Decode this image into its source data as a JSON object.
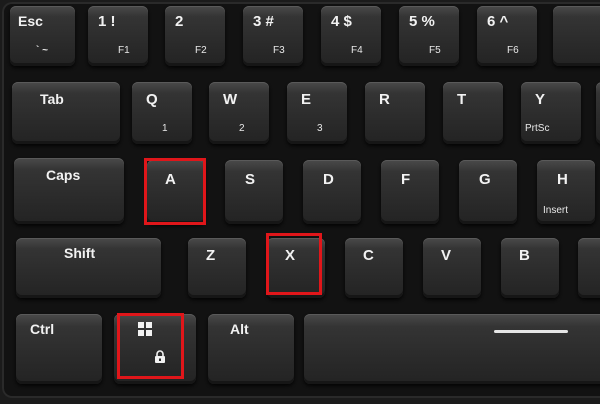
{
  "keys": {
    "esc": {
      "label": "Esc",
      "sub": "` ~"
    },
    "one": {
      "label": "1 !",
      "sub": "F1"
    },
    "two": {
      "label": "2",
      "sub": "F2"
    },
    "three": {
      "label": "3 #",
      "sub": "F3"
    },
    "four": {
      "label": "4 $",
      "sub": "F4"
    },
    "five": {
      "label": "5 %",
      "sub": "F5"
    },
    "six": {
      "label": "6 ^",
      "sub": "F6"
    },
    "tab": {
      "label": "Tab"
    },
    "q": {
      "label": "Q",
      "sub": "1"
    },
    "w": {
      "label": "W",
      "sub": "2"
    },
    "e": {
      "label": "E",
      "sub": "3"
    },
    "r": {
      "label": "R"
    },
    "t": {
      "label": "T"
    },
    "y": {
      "label": "Y",
      "sub": "PrtSc"
    },
    "caps": {
      "label": "Caps"
    },
    "a": {
      "label": "A"
    },
    "s": {
      "label": "S"
    },
    "d": {
      "label": "D"
    },
    "f": {
      "label": "F"
    },
    "g": {
      "label": "G"
    },
    "h": {
      "label": "H",
      "sub": "Insert"
    },
    "shift": {
      "label": "Shift"
    },
    "z": {
      "label": "Z"
    },
    "x": {
      "label": "X"
    },
    "c": {
      "label": "C"
    },
    "v": {
      "label": "V"
    },
    "b": {
      "label": "B"
    },
    "ctrl": {
      "label": "Ctrl"
    },
    "alt": {
      "label": "Alt"
    }
  },
  "colors": {
    "highlight": "#e0161a",
    "key_face": "#2b2b2b",
    "legend": "#f2f2f2"
  },
  "icons": {
    "windows": "windows-icon",
    "lock": "lock-icon"
  }
}
